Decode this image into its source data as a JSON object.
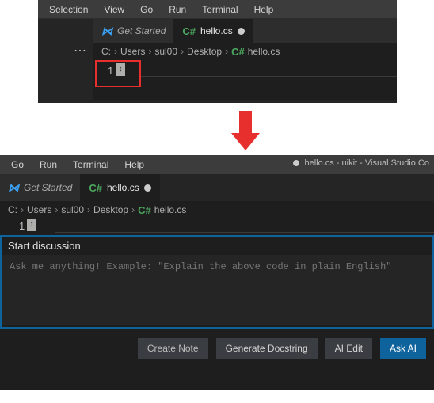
{
  "top": {
    "menu": [
      "Selection",
      "View",
      "Go",
      "Run",
      "Terminal",
      "Help"
    ],
    "more_icon": "⋯",
    "tabs": [
      {
        "icon": "vs",
        "label": "Get Started",
        "active": false,
        "italic": true,
        "dirty": false
      },
      {
        "icon": "cs",
        "label": "hello.cs",
        "active": true,
        "italic": false,
        "dirty": true
      }
    ],
    "breadcrumb": [
      "C:",
      "Users",
      "sul00",
      "Desktop"
    ],
    "breadcrumb_file": "hello.cs",
    "line_number": "1",
    "cursor_glyph": "↕"
  },
  "bottom": {
    "menu": [
      "Go",
      "Run",
      "Terminal",
      "Help"
    ],
    "window_title": "hello.cs - uikit - Visual Studio Co",
    "tabs": [
      {
        "icon": "vs",
        "label": "Get Started",
        "active": false,
        "italic": true,
        "dirty": false
      },
      {
        "icon": "cs",
        "label": "hello.cs",
        "active": true,
        "italic": false,
        "dirty": true
      }
    ],
    "breadcrumb": [
      "C:",
      "Users",
      "sul00",
      "Desktop"
    ],
    "breadcrumb_file": "hello.cs",
    "line_number": "1",
    "cursor_glyph": "↕",
    "panel_title": "Start discussion",
    "panel_placeholder": "Ask me anything! Example: \"Explain the above code in plain English\"",
    "buttons": {
      "create_note": "Create Note",
      "generate_docstring": "Generate Docstring",
      "ai_edit": "AI Edit",
      "ask_ai": "Ask AI"
    }
  }
}
